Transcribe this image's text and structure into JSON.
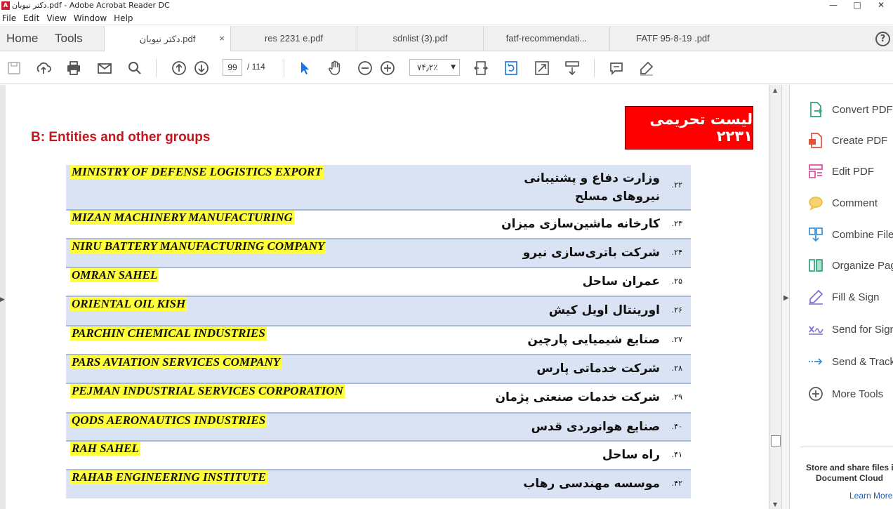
{
  "window": {
    "title": "دکتر نیوبان.pdf - Adobe Acrobat Reader DC",
    "controls": [
      "—",
      "□",
      "✕"
    ]
  },
  "menu": [
    "File",
    "Edit",
    "View",
    "Window",
    "Help"
  ],
  "nav_tabs": {
    "home": "Home",
    "tools": "Tools"
  },
  "doc_tabs": [
    {
      "label": "دکتر نیوبان.pdf",
      "active": true,
      "close": "×"
    },
    {
      "label": "res 2231 e.pdf",
      "active": false
    },
    {
      "label": "sdnlist (3).pdf",
      "active": false
    },
    {
      "label": "fatf-recommendati...",
      "active": false
    },
    {
      "label": "FATF  95-8-19  .pdf",
      "active": false
    }
  ],
  "help": "?",
  "toolbar": {
    "icons": [
      "save-icon",
      "upload-icon",
      "print-icon",
      "email-icon",
      "search-icon",
      "page-up-icon",
      "page-down-icon",
      "select-cursor-icon",
      "hand-icon",
      "zoom-out-icon",
      "zoom-in-icon",
      "fit-page-icon",
      "rotate-icon",
      "fullscreen-icon",
      "scroll-mode-icon",
      "comment-icon",
      "highlight-pen-icon"
    ],
    "page_current": "99",
    "page_total": "/  114",
    "zoom": "۷۴٫۲٪"
  },
  "document": {
    "section_heading": "B: Entities and other groups",
    "banner": "لیست تحریمی ۲۲۳۱",
    "colors": {
      "highlight": "#ffff3c",
      "row_shade": "#dae3f3",
      "banner": "#ff0000",
      "heading": "#c5161d"
    },
    "entities": [
      {
        "num": "۲۲.",
        "en": "MINISTRY OF DEFENSE LOGISTICS EXPORT",
        "fa": "وزارت دفاع و پشتیبانی نیروهای مسلح"
      },
      {
        "num": "۲۳.",
        "en": "MIZAN MACHINERY MANUFACTURING",
        "fa": "کارخانه ماشین‌سازی میزان"
      },
      {
        "num": "۲۴.",
        "en": "NIRU BATTERY MANUFACTURING COMPANY",
        "fa": "شرکت باتری‌سازی نیرو"
      },
      {
        "num": "۲۵.",
        "en": "OMRAN SAHEL",
        "fa": "عمران ساحل"
      },
      {
        "num": "۲۶.",
        "en": "ORIENTAL OIL KISH",
        "fa": "اورینتال اویل کیش"
      },
      {
        "num": "۲۷.",
        "en": "PARCHIN CHEMICAL INDUSTRIES",
        "fa": "صنایع شیمیایی پارچین"
      },
      {
        "num": "۲۸.",
        "en": "PARS AVIATION SERVICES COMPANY",
        "fa": "شرکت خدماتی پارس"
      },
      {
        "num": "۲۹.",
        "en": "PEJMAN INDUSTRIAL SERVICES CORPORATION",
        "fa": "شرکت خدمات صنعتی پژمان"
      },
      {
        "num": "۴۰.",
        "en": "QODS AERONAUTICS INDUSTRIES",
        "fa": "صنایع هوانوردی قدس"
      },
      {
        "num": "۴۱.",
        "en": "RAH SAHEL",
        "fa": "راه ساحل"
      },
      {
        "num": "۴۲.",
        "en": "RAHAB ENGINEERING INSTITUTE",
        "fa": "موسسه مهندسی رهاب"
      }
    ]
  },
  "tools_panel": {
    "items": [
      {
        "label": "Convert PDF",
        "icon": "convert-pdf-icon",
        "color": "#2fa37a"
      },
      {
        "label": "Create PDF",
        "icon": "create-pdf-icon",
        "color": "#e0533b"
      },
      {
        "label": "Edit PDF",
        "icon": "edit-pdf-icon",
        "color": "#d94fa0"
      },
      {
        "label": "Comment",
        "icon": "comment-bubble-icon",
        "color": "#f2b632"
      },
      {
        "label": "Combine Files",
        "icon": "combine-files-icon",
        "color": "#3a8fd9"
      },
      {
        "label": "Organize Pages",
        "icon": "organize-pages-icon",
        "color": "#2fa37a"
      },
      {
        "label": "Fill & Sign",
        "icon": "fill-sign-icon",
        "color": "#7b6fd1"
      },
      {
        "label": "Send for Signature",
        "icon": "send-signature-icon",
        "color": "#7b6fd1"
      },
      {
        "label": "Send & Track",
        "icon": "send-track-icon",
        "color": "#3a8fd9"
      },
      {
        "label": "More Tools",
        "icon": "more-tools-icon",
        "color": "#555555"
      }
    ],
    "cloud_line1": "Store and share files in the",
    "cloud_line2": "Document Cloud",
    "learn_more": "Learn More"
  }
}
